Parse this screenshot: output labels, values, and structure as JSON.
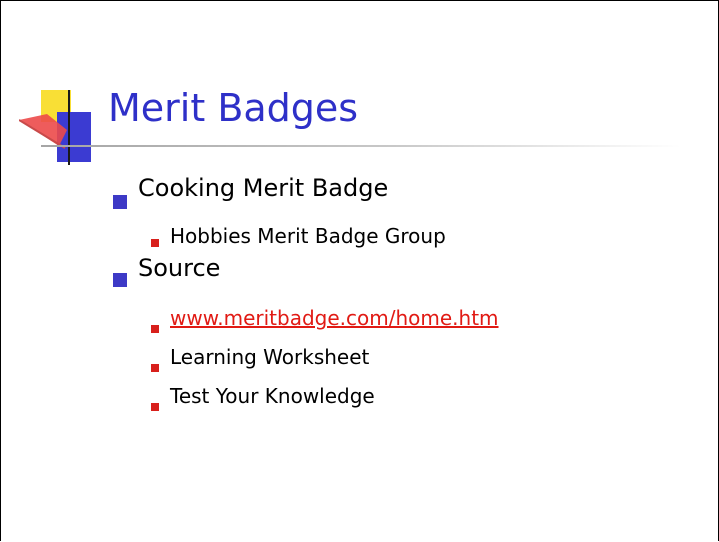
{
  "slide": {
    "title": "Merit Badges",
    "colors": {
      "title": "#2e30c8",
      "level1_bullet": "#3d39c6",
      "level2_bullet": "#d8201c",
      "link": "#e11a14",
      "logo_yellow": "#f9df35",
      "logo_blue": "#3b3bd2",
      "logo_red": "#ec4a4a"
    },
    "bullets": [
      {
        "text": "Cooking Merit Badge",
        "subitems": [
          {
            "text": "Hobbies Merit Badge Group"
          }
        ]
      },
      {
        "text": "Source",
        "subitems": [
          {
            "text": "www.meritbadge.com/home.htm",
            "link": true
          },
          {
            "text": "Learning Worksheet"
          },
          {
            "text": "Test Your Knowledge"
          }
        ]
      }
    ]
  }
}
